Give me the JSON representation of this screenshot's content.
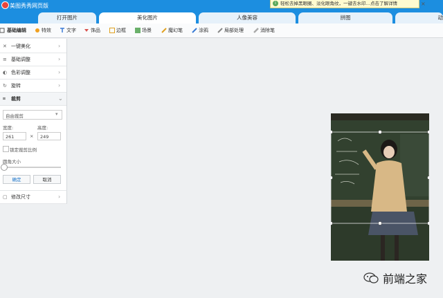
{
  "app": {
    "title": "美图秀秀网页版"
  },
  "notice": {
    "icon": "info-icon",
    "text": "轻松去掉黑眼圈、淡化眼角纹，一键去水印…点击了解详情",
    "close": "×"
  },
  "tabs": [
    {
      "label": "打开图片",
      "active": false
    },
    {
      "label": "美化图片",
      "active": true
    },
    {
      "label": "人像美容",
      "active": false
    },
    {
      "label": "拼图",
      "active": false
    },
    {
      "label": "动",
      "active": false
    }
  ],
  "toolbar": [
    {
      "label": "基础编辑",
      "icon": "edit-icon",
      "active": true
    },
    {
      "label": "特效",
      "icon": "effects-icon"
    },
    {
      "label": "文字",
      "icon": "text-icon"
    },
    {
      "label": "饰品",
      "icon": "sticker-icon"
    },
    {
      "label": "边框",
      "icon": "frame-icon"
    },
    {
      "label": "场景",
      "icon": "scene-icon"
    },
    {
      "label": "魔幻笔",
      "icon": "magic-pen-icon"
    },
    {
      "label": "涂鸦",
      "icon": "doodle-icon"
    },
    {
      "label": "局部处理",
      "icon": "local-adjust-icon"
    },
    {
      "label": "消除笔",
      "icon": "eraser-icon"
    }
  ],
  "sidebar": {
    "items": [
      {
        "label": "一键美化",
        "icon": "magic-wand-icon",
        "icon_glyph": "✕"
      },
      {
        "label": "基础调整",
        "icon": "sliders-icon",
        "icon_glyph": "≡"
      },
      {
        "label": "色彩调整",
        "icon": "palette-icon",
        "icon_glyph": "◐"
      },
      {
        "label": "旋转",
        "icon": "rotate-icon",
        "icon_glyph": "↻"
      },
      {
        "label": "裁剪",
        "icon": "crop-icon",
        "icon_glyph": "⌗",
        "open": true
      }
    ],
    "crop": {
      "mode_value": "自由裁剪",
      "width_label": "宽度:",
      "height_label": "高度:",
      "width_value": "261",
      "height_value": "249",
      "times": "×",
      "lock_ratio_label": "锁定裁剪比例",
      "corner_label": "圆角大小",
      "corner_value": 0,
      "ok_label": "确定",
      "cancel_label": "取消"
    },
    "resize": {
      "label": "修改尺寸",
      "icon": "resize-icon",
      "icon_glyph": "▢"
    },
    "chevron": "›",
    "open_chevron": "⌄"
  },
  "watermark": {
    "text": "前端之家",
    "icon": "wechat-icon"
  },
  "colors": {
    "titlebar": "#1c8ee0",
    "accent": "#1a73c9"
  }
}
